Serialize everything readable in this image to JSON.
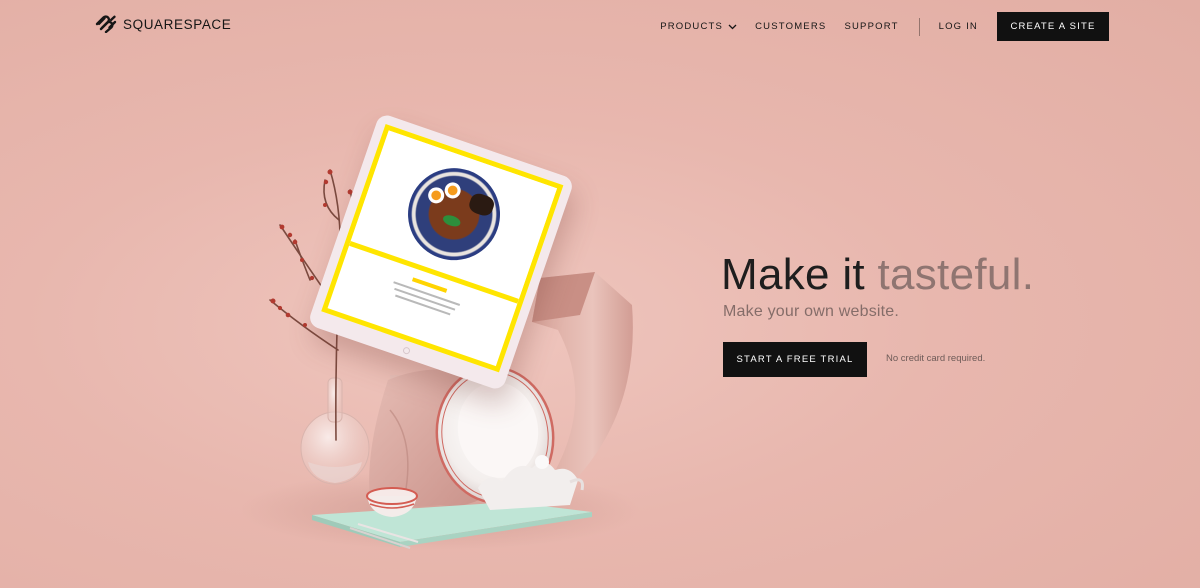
{
  "brand": {
    "name": "SQUARESPACE",
    "logo_icon": "squarespace-logo-icon"
  },
  "nav": {
    "products": "PRODUCTS",
    "customers": "CUSTOMERS",
    "support": "SUPPORT",
    "login": "LOG IN",
    "create_site": "CREATE A SITE"
  },
  "hero": {
    "title_main": "Make it ",
    "title_accent": "tasteful.",
    "subtitle": "Make your own website.",
    "cta": "START A FREE TRIAL",
    "note": "No credit card required."
  },
  "colors": {
    "background": "#e8b7ae",
    "button": "#111111",
    "button_text": "#ffffff",
    "accent_text": "#8f7571",
    "tablet_border": "#ffe500"
  }
}
